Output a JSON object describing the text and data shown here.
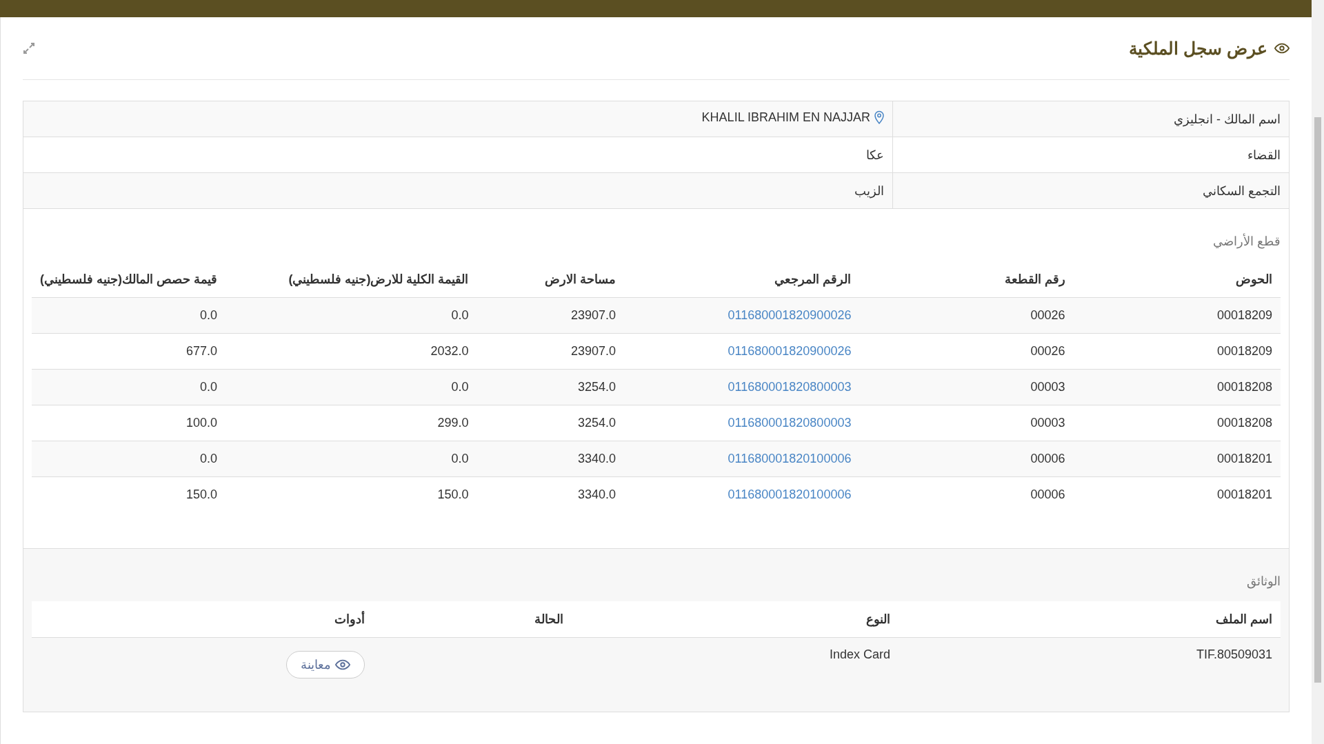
{
  "header": {
    "title": "عرض سجل الملكية"
  },
  "owner_info": [
    {
      "label": "اسم المالك - انجليزي",
      "value": "KHALIL IBRAHIM EN NAJJAR",
      "kind": "location"
    },
    {
      "label": "القضاء",
      "value": "عكا",
      "kind": "plain"
    },
    {
      "label": "التجمع السكاني",
      "value": "الزيب",
      "kind": "plain"
    }
  ],
  "land_parcels": {
    "heading": "قطع الأراضي",
    "columns": [
      "الحوض",
      "رقم القطعة",
      "الرقم المرجعي",
      "مساحة الارض",
      "القيمة الكلية للارض(جنيه فلسطيني)",
      "قيمة حصص المالك(جنيه فلسطيني)"
    ],
    "rows": [
      [
        "00018209",
        "00026",
        "011680001820900026",
        "23907.0",
        "0.0",
        "0.0"
      ],
      [
        "00018209",
        "00026",
        "011680001820900026",
        "23907.0",
        "2032.0",
        "677.0"
      ],
      [
        "00018208",
        "00003",
        "011680001820800003",
        "3254.0",
        "0.0",
        "0.0"
      ],
      [
        "00018208",
        "00003",
        "011680001820800003",
        "3254.0",
        "299.0",
        "100.0"
      ],
      [
        "00018201",
        "00006",
        "011680001820100006",
        "3340.0",
        "0.0",
        "0.0"
      ],
      [
        "00018201",
        "00006",
        "011680001820100006",
        "3340.0",
        "150.0",
        "150.0"
      ]
    ]
  },
  "documents": {
    "heading": "الوثائق",
    "columns": [
      "اسم الملف",
      "النوع",
      "الحالة",
      "أدوات"
    ],
    "rows": [
      {
        "file_name": "TIF.80509031",
        "type": "Index Card",
        "preview_button": "معاينة"
      }
    ]
  }
}
